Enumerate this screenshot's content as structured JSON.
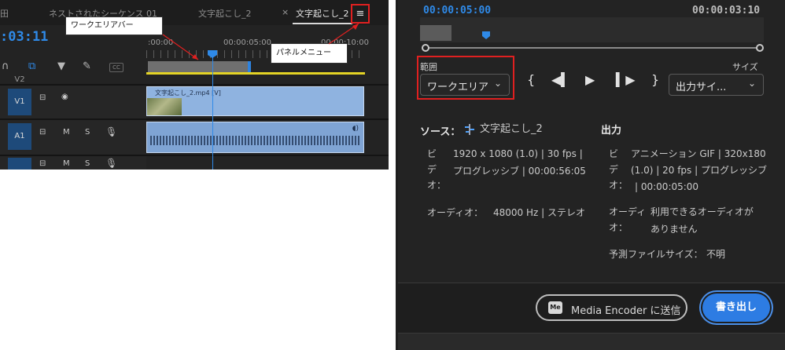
{
  "timeline": {
    "tabs": [
      {
        "label": "ネストされたシーケンス 01"
      },
      {
        "label": "文字起こし_2"
      },
      {
        "label": "文字起こし_2"
      }
    ],
    "tab_close": "×",
    "timecode": ":03:11",
    "ruler_labels": [
      ":00:00",
      "00:00:05:00",
      "00:00:10:00"
    ],
    "tracks": {
      "v2": "V2",
      "v1": "V1",
      "a1": "A1",
      "a1_m": "M",
      "a1_s": "S",
      "a2_m": "M",
      "a2_s": "S"
    },
    "clip_label": "文字起こし_2.mp4 [V]",
    "callouts": {
      "work_area_bar": "ワークエリアバー",
      "panel_menu": "パネルメニュー"
    },
    "cc_label": "CC"
  },
  "export": {
    "preview_start": "00:00:05:00",
    "preview_duration": "00:00:03:10",
    "range_label": "範囲",
    "range_value": "ワークエリア",
    "size_label": "サイズ",
    "size_value": "出力サイ...",
    "source": {
      "heading": "ソース：",
      "name": "文字起こし_2",
      "video_label": "ビ\nデ\nオ：",
      "video_line1": "1920 x 1080 (1.0) | 30 fps |",
      "video_line2": "プログレッシブ | 00:00:56:05",
      "audio_label": "オーディオ：",
      "audio_value": "48000 Hz | ステレオ"
    },
    "output": {
      "heading": "出力",
      "video_label": "ビ\nデ\nオ：",
      "video_line1": "アニメーション GIF | 320x180",
      "video_line2": "(1.0) | 20 fps | プログレッシブ",
      "video_line3": "| 00:00:05:00",
      "audio_label": "オーディ\nオ：",
      "audio_line1": "利用できるオーディオが",
      "audio_line2": "ありません",
      "size_label": "予測ファイルサイズ：",
      "size_value": "不明"
    },
    "buttons": {
      "media_encoder": "Media Encoder に送信",
      "media_encoder_badge": "Me",
      "export": "書き出し"
    }
  },
  "colors": {
    "accent": "#2f8ae8",
    "annotation_red": "#e02020",
    "export_button": "#2d7ce3"
  }
}
